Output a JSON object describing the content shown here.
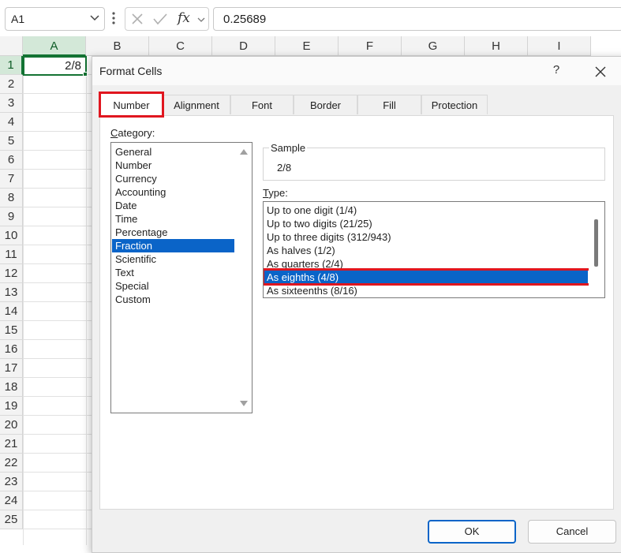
{
  "formula_bar": {
    "name_box": "A1",
    "cancel_icon": "close-icon",
    "enter_icon": "check-icon",
    "fx_label": "fx",
    "formula": "0.25689"
  },
  "grid": {
    "columns": [
      "A",
      "B",
      "C",
      "D",
      "E",
      "F",
      "G",
      "H",
      "I"
    ],
    "rows": [
      "1",
      "2",
      "3",
      "4",
      "5",
      "6",
      "7",
      "8",
      "9",
      "10",
      "11",
      "12",
      "13",
      "14",
      "15",
      "16",
      "17",
      "18",
      "19",
      "20",
      "21",
      "22",
      "23",
      "24",
      "25"
    ],
    "active_cell_value": "2/8",
    "accent_color": "#137333"
  },
  "dialog": {
    "title": "Format Cells",
    "help": "?",
    "tabs": [
      "Number",
      "Alignment",
      "Font",
      "Border",
      "Fill",
      "Protection"
    ],
    "active_tab": "Number",
    "category_label_u": "C",
    "category_label_rest": "ategory:",
    "categories": [
      "General",
      "Number",
      "Currency",
      "Accounting",
      "Date",
      "Time",
      "Percentage",
      "Fraction",
      "Scientific",
      "Text",
      "Special",
      "Custom"
    ],
    "selected_category": "Fraction",
    "sample_label": "Sample",
    "sample_value": "2/8",
    "type_label_u": "T",
    "type_label_rest": "ype:",
    "types": [
      "Up to one digit (1/4)",
      "Up to two digits (21/25)",
      "Up to three digits (312/943)",
      "As halves (1/2)",
      "As quarters (2/4)",
      "As eighths (4/8)",
      "As sixteenths (8/16)"
    ],
    "selected_type": "As eighths (4/8)",
    "ok_label": "OK",
    "cancel_label": "Cancel",
    "highlight_color": "#e0161f",
    "selection_color": "#0a64c8"
  }
}
